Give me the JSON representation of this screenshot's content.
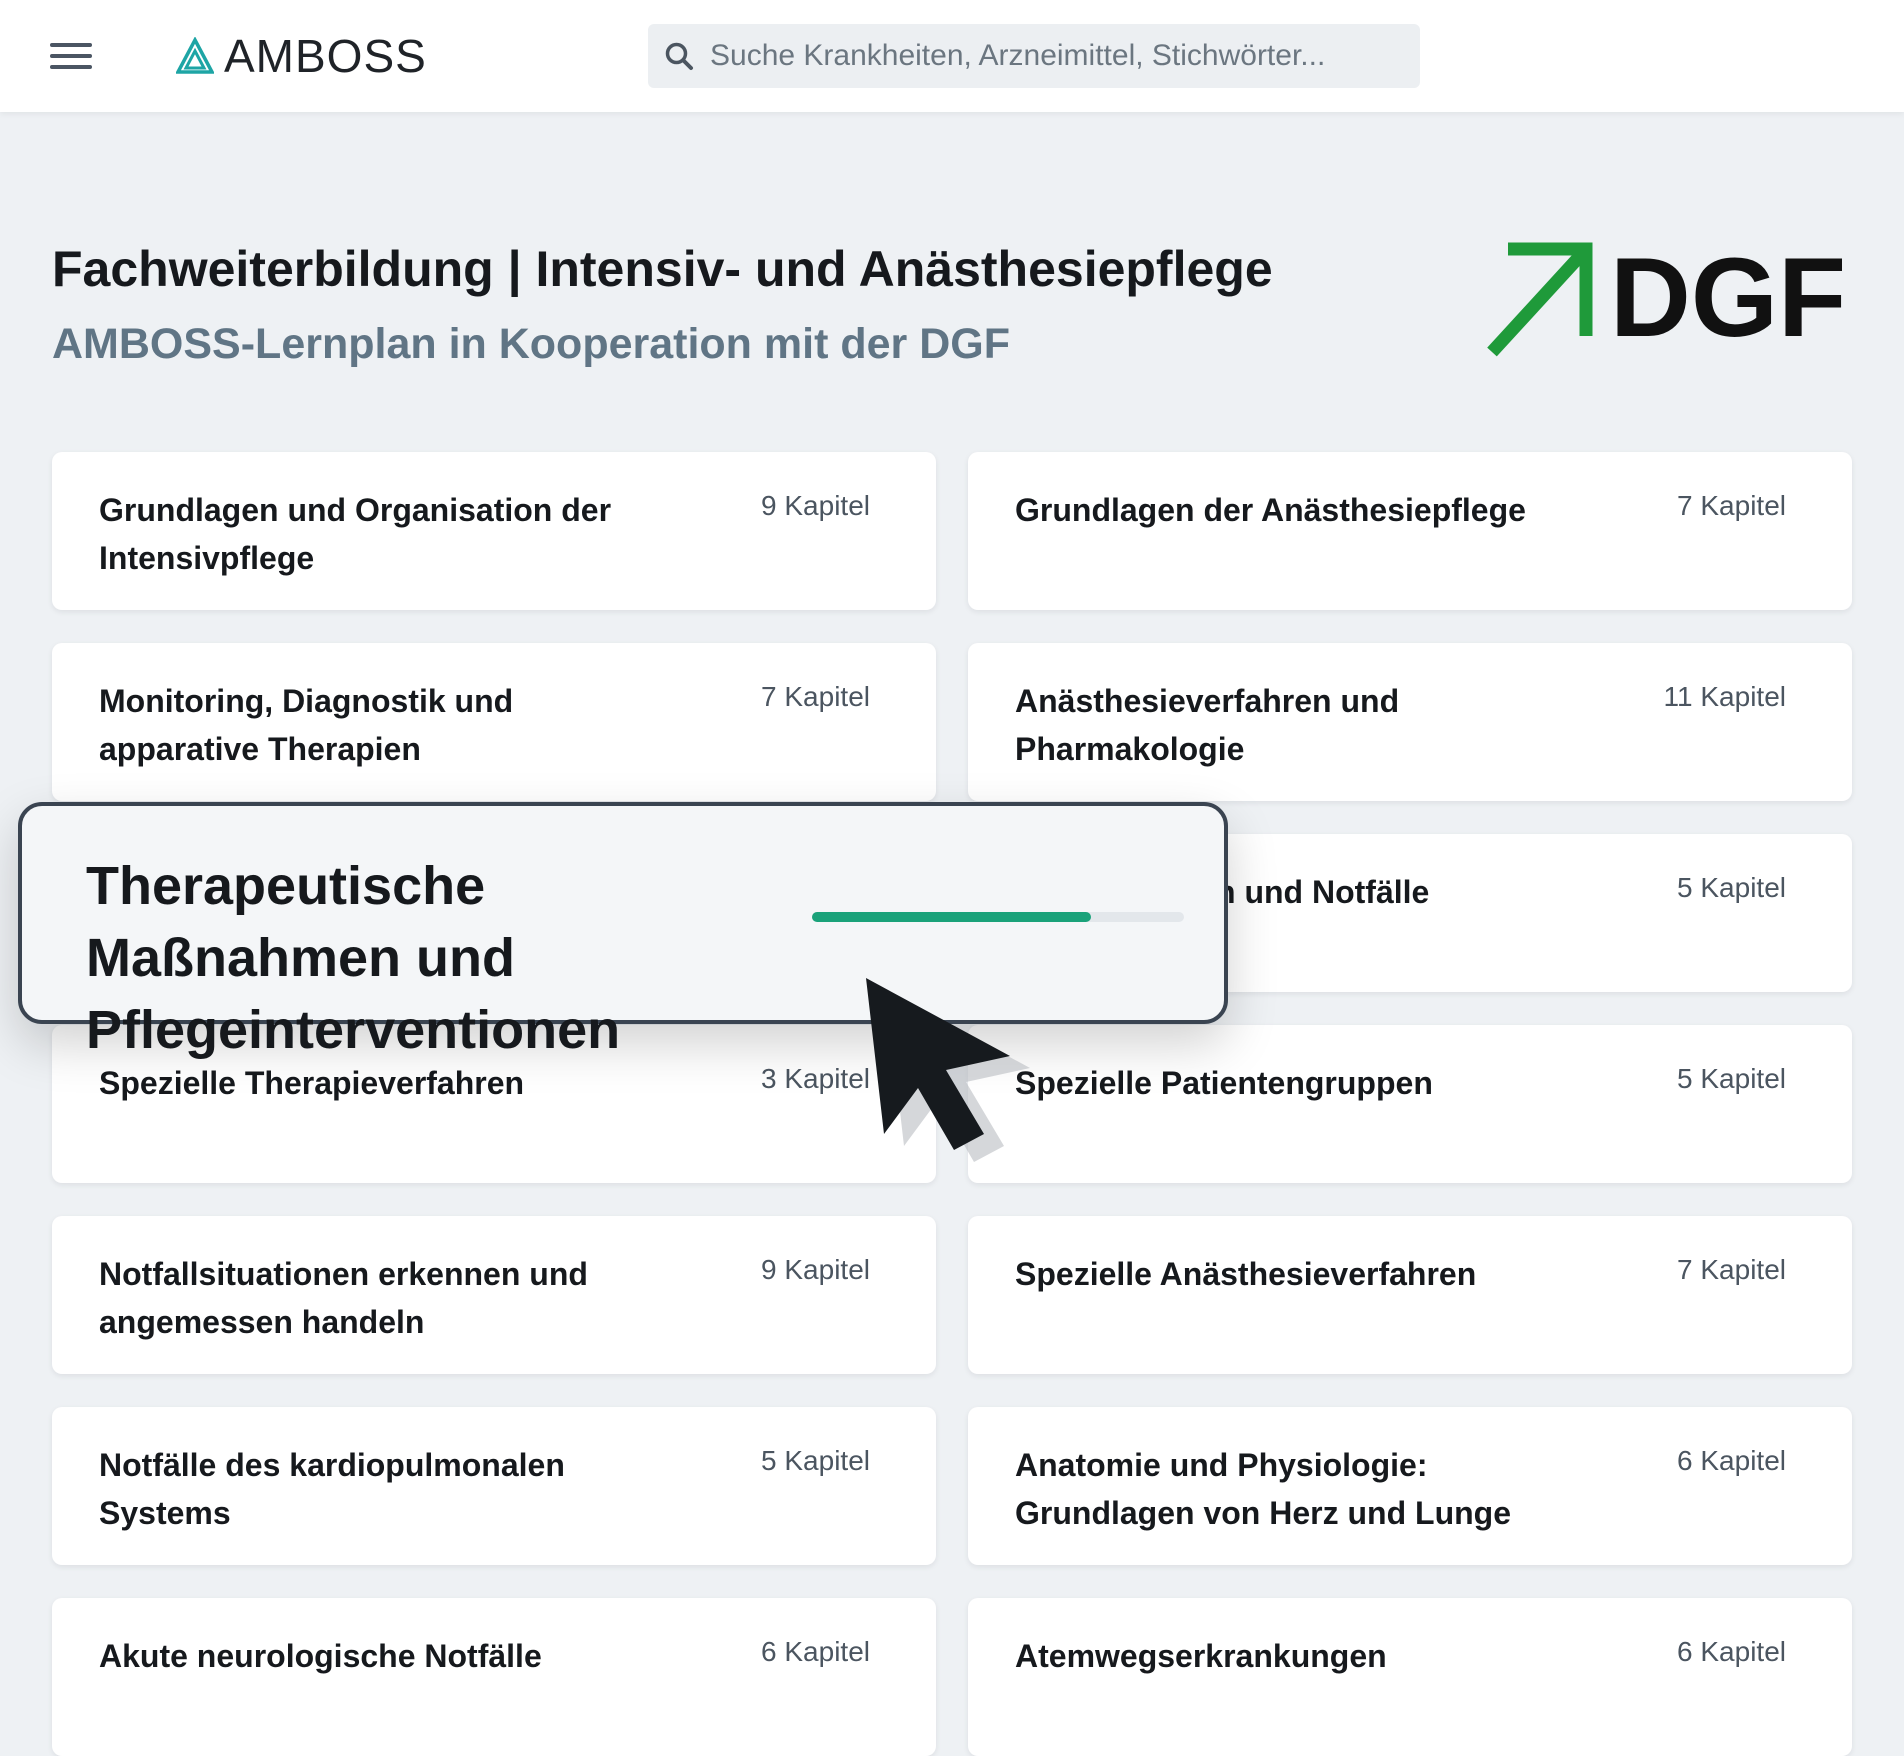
{
  "header": {
    "brand": "AMBOSS",
    "search_placeholder": "Suche Krankheiten, Arzneimittel, Stichwörter..."
  },
  "page": {
    "title": "Fachweiterbildung | Intensiv- und Anästhesiepflege",
    "subtitle": "AMBOSS-Lernplan in Kooperation mit der DGF",
    "partner_logo_text": "DGF"
  },
  "cards": [
    {
      "title": "Grundlagen und Organisation der Intensivpflege",
      "count": "9 Kapitel"
    },
    {
      "title": "Grundlagen der Anästhesiepflege",
      "count": "7 Kapitel"
    },
    {
      "title": "Monitoring, Diagnostik und apparative Therapien",
      "count": "7 Kapitel"
    },
    {
      "title": "Anästhesieverfahren und Pharmakologie",
      "count": "11 Kapitel"
    },
    {
      "title": "",
      "count": ""
    },
    {
      "title": "n und Notfälle",
      "count": "5 Kapitel"
    },
    {
      "title": "Spezielle Therapieverfahren",
      "count": "3 Kapitel"
    },
    {
      "title": "Spezielle Patientengruppen",
      "count": "5 Kapitel"
    },
    {
      "title": "Notfallsituationen erkennen und angemessen handeln",
      "count": "9 Kapitel"
    },
    {
      "title": "Spezielle Anästhesieverfahren",
      "count": "7 Kapitel"
    },
    {
      "title": "Notfälle des kardiopulmonalen Systems",
      "count": "5 Kapitel"
    },
    {
      "title": "Anatomie und Physiologie: Grundlagen von Herz und Lunge",
      "count": "6 Kapitel"
    },
    {
      "title": "Akute neurologische Notfälle",
      "count": "6 Kapitel"
    },
    {
      "title": "Atemwegserkrankungen",
      "count": "6 Kapitel"
    }
  ],
  "highlight": {
    "title": "Therapeutische Maßnahmen und Pflegeinterventionen",
    "progress_percent": 75
  },
  "colors": {
    "accent_green": "#1aa27a",
    "dgf_green": "#1f9a3a",
    "subtitle": "#607585"
  },
  "icons": [
    "menu-icon",
    "amboss-logo-icon",
    "search-icon",
    "dgf-arrow-icon",
    "mouse-cursor-icon"
  ]
}
